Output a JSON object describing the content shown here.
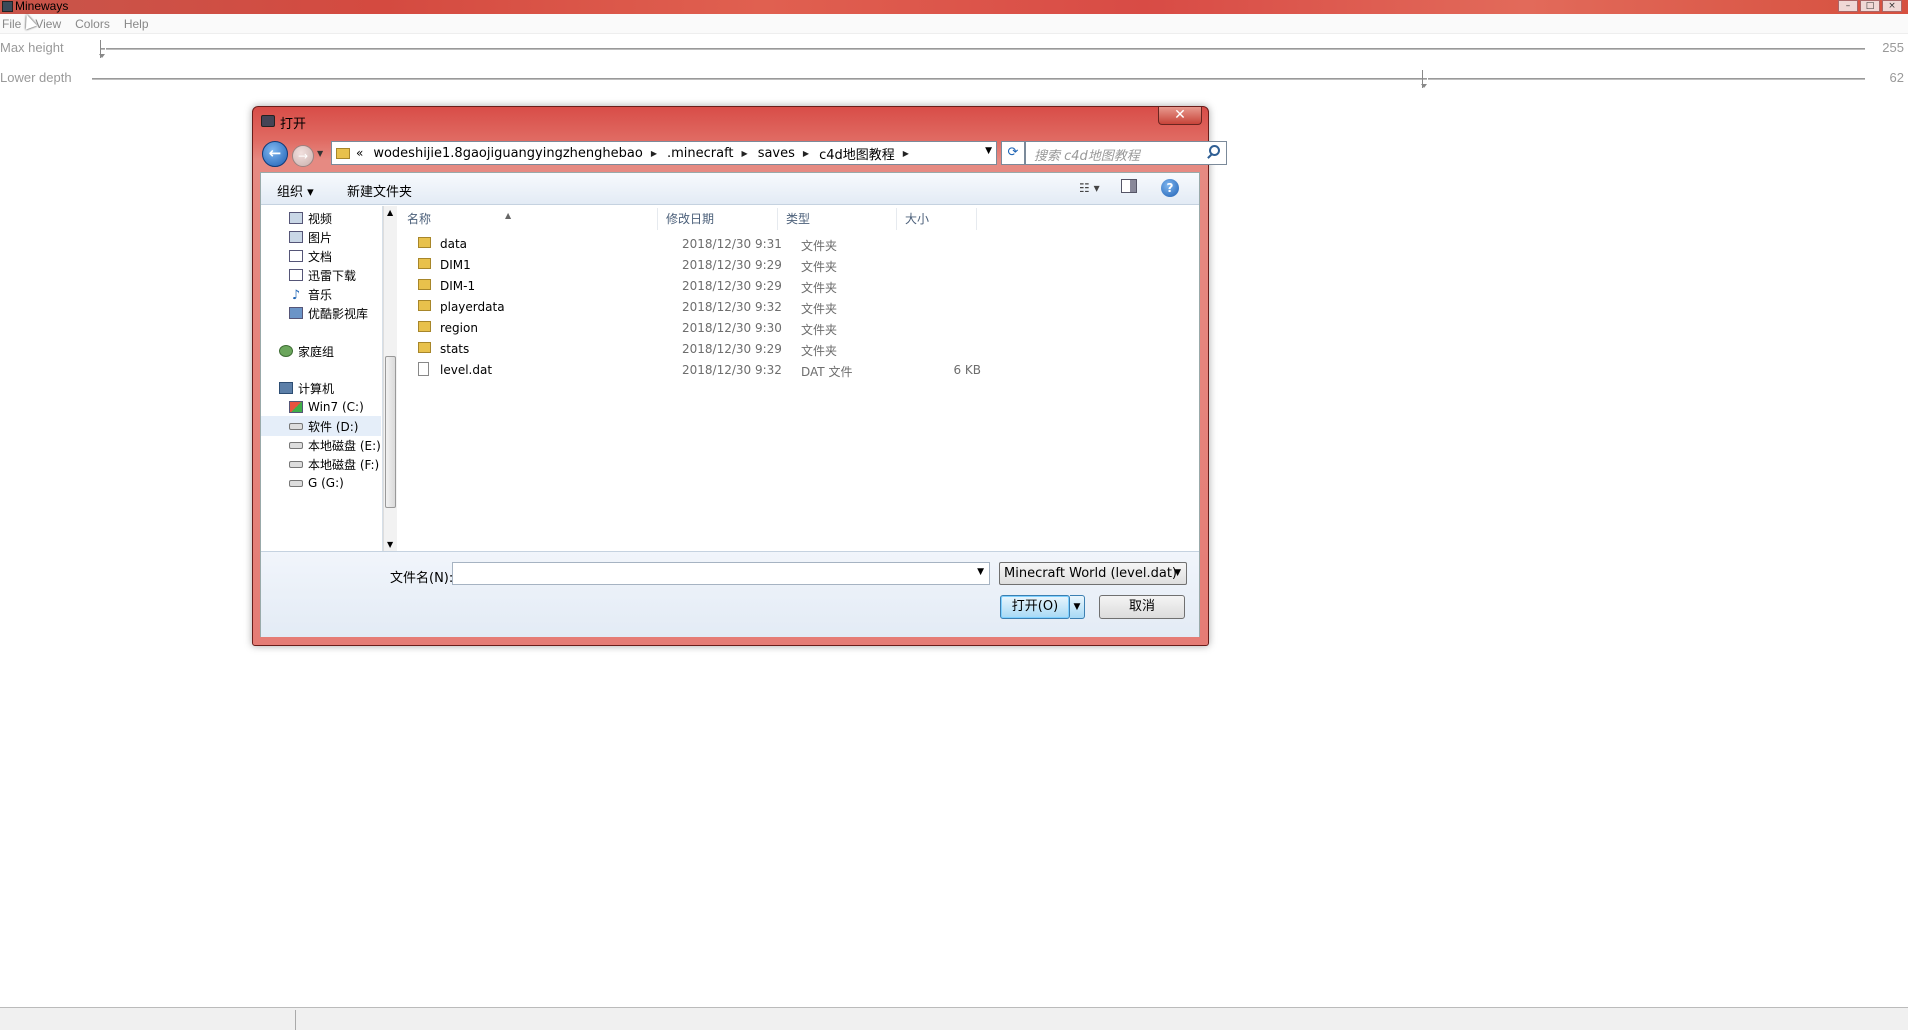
{
  "app": {
    "title": "Mineways",
    "window_controls": [
      "–",
      "□",
      "×"
    ]
  },
  "menu": {
    "items": [
      "File",
      "View",
      "Colors",
      "Help"
    ]
  },
  "sliders": {
    "max_height": {
      "label": "Max height",
      "value": "255",
      "level": 0.0
    },
    "lower_depth": {
      "label": "Lower depth",
      "value": "62",
      "level": 0.75
    }
  },
  "dialog": {
    "title": "打开",
    "close_label": "✕",
    "address": {
      "chevrons": "«",
      "crumbs": [
        "wodeshijie1.8gaojiguangyingzhenghebao",
        ".minecraft",
        "saves",
        "c4d地图教程"
      ]
    },
    "search_placeholder": "搜索 c4d地图教程",
    "toolbar": {
      "organize": "组织 ▾",
      "new_folder": "新建文件夹"
    },
    "nav_items": [
      {
        "label": "视频",
        "icon": "video-icon"
      },
      {
        "label": "图片",
        "icon": "pictures-icon"
      },
      {
        "label": "文档",
        "icon": "documents-icon"
      },
      {
        "label": "迅雷下载",
        "icon": "download-icon"
      },
      {
        "label": "音乐",
        "icon": "music-icon"
      },
      {
        "label": "优酷影视库",
        "icon": "video-library-icon"
      },
      {
        "label": "家庭组",
        "icon": "homegroup-icon"
      },
      {
        "label": "计算机",
        "icon": "computer-icon"
      },
      {
        "label": "Win7 (C:)",
        "icon": "system-drive-icon"
      },
      {
        "label": "软件 (D:)",
        "icon": "drive-icon"
      },
      {
        "label": "本地磁盘 (E:)",
        "icon": "drive-icon"
      },
      {
        "label": "本地磁盘 (F:)",
        "icon": "drive-icon"
      },
      {
        "label": "G (G:)",
        "icon": "drive-icon"
      }
    ],
    "columns": {
      "name": "名称",
      "modified": "修改日期",
      "type": "类型",
      "size": "大小"
    },
    "files": [
      {
        "name": "data",
        "date": "2018/12/30 9:31",
        "type": "文件夹",
        "size": "",
        "kind": "folder"
      },
      {
        "name": "DIM1",
        "date": "2018/12/30 9:29",
        "type": "文件夹",
        "size": "",
        "kind": "folder"
      },
      {
        "name": "DIM-1",
        "date": "2018/12/30 9:29",
        "type": "文件夹",
        "size": "",
        "kind": "folder"
      },
      {
        "name": "playerdata",
        "date": "2018/12/30 9:32",
        "type": "文件夹",
        "size": "",
        "kind": "folder"
      },
      {
        "name": "region",
        "date": "2018/12/30 9:30",
        "type": "文件夹",
        "size": "",
        "kind": "folder"
      },
      {
        "name": "stats",
        "date": "2018/12/30 9:29",
        "type": "文件夹",
        "size": "",
        "kind": "folder"
      },
      {
        "name": "level.dat",
        "date": "2018/12/30 9:32",
        "type": "DAT 文件",
        "size": "6 KB",
        "kind": "file"
      }
    ],
    "filename_label": "文件名(N):",
    "filename_value": "",
    "filter": "Minecraft World (level.dat)",
    "open_label": "打开(O)",
    "cancel_label": "取消"
  }
}
